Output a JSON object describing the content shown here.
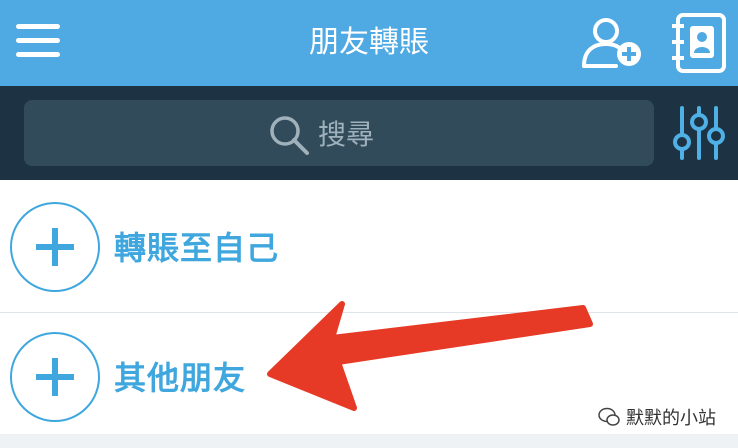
{
  "header": {
    "title": "朋友轉賬",
    "background": "#4fa9e3",
    "menu_icon": "hamburger-menu-icon",
    "add_friend_icon": "add-user-icon",
    "contacts_icon": "contacts-book-icon"
  },
  "search": {
    "placeholder": "搜尋",
    "icon": "search-icon",
    "filter_icon": "sliders-icon"
  },
  "list": {
    "items": [
      {
        "label": "轉賬至自己",
        "icon": "plus-circle-icon"
      },
      {
        "label": "其他朋友",
        "icon": "plus-circle-icon"
      }
    ]
  },
  "annotation": {
    "arrow_color": "#e63a26",
    "icon": "red-arrow-icon"
  },
  "watermark": {
    "text": "默默的小站",
    "icon": "wechat-icon"
  },
  "colors": {
    "accent": "#3fa7de",
    "dark_bar": "#1d3242",
    "search_box": "#324b5a"
  }
}
